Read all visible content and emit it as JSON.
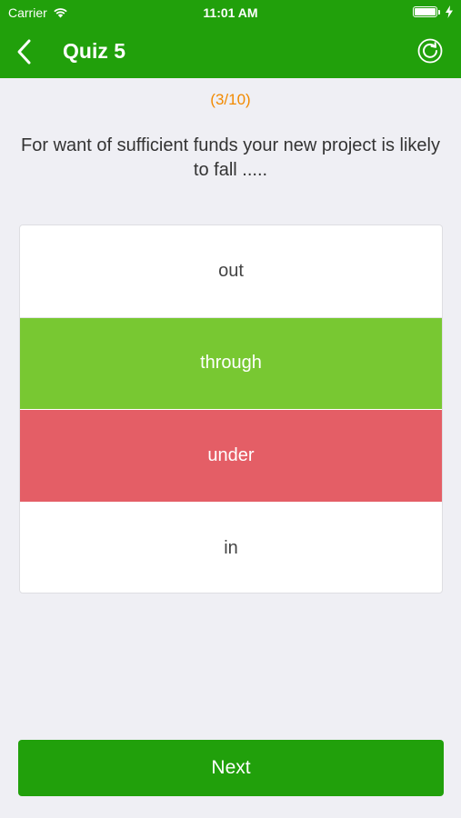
{
  "status_bar": {
    "carrier": "Carrier",
    "time": "11:01 AM"
  },
  "nav": {
    "title": "Quiz 5",
    "back_icon": "chevron-left-icon",
    "reload_icon": "reload-icon"
  },
  "quiz": {
    "counter": "(3/10)",
    "question": "For want of sufficient funds your new project is likely to fall .....",
    "options": [
      {
        "label": "out",
        "state": "neutral"
      },
      {
        "label": "through",
        "state": "correct"
      },
      {
        "label": "under",
        "state": "wrong"
      },
      {
        "label": "in",
        "state": "neutral"
      }
    ]
  },
  "next_label": "Next",
  "colors": {
    "brand_green": "#21a00b",
    "correct": "#78c832",
    "wrong": "#e45e66",
    "counter": "#f28a00",
    "background": "#efeff4"
  }
}
